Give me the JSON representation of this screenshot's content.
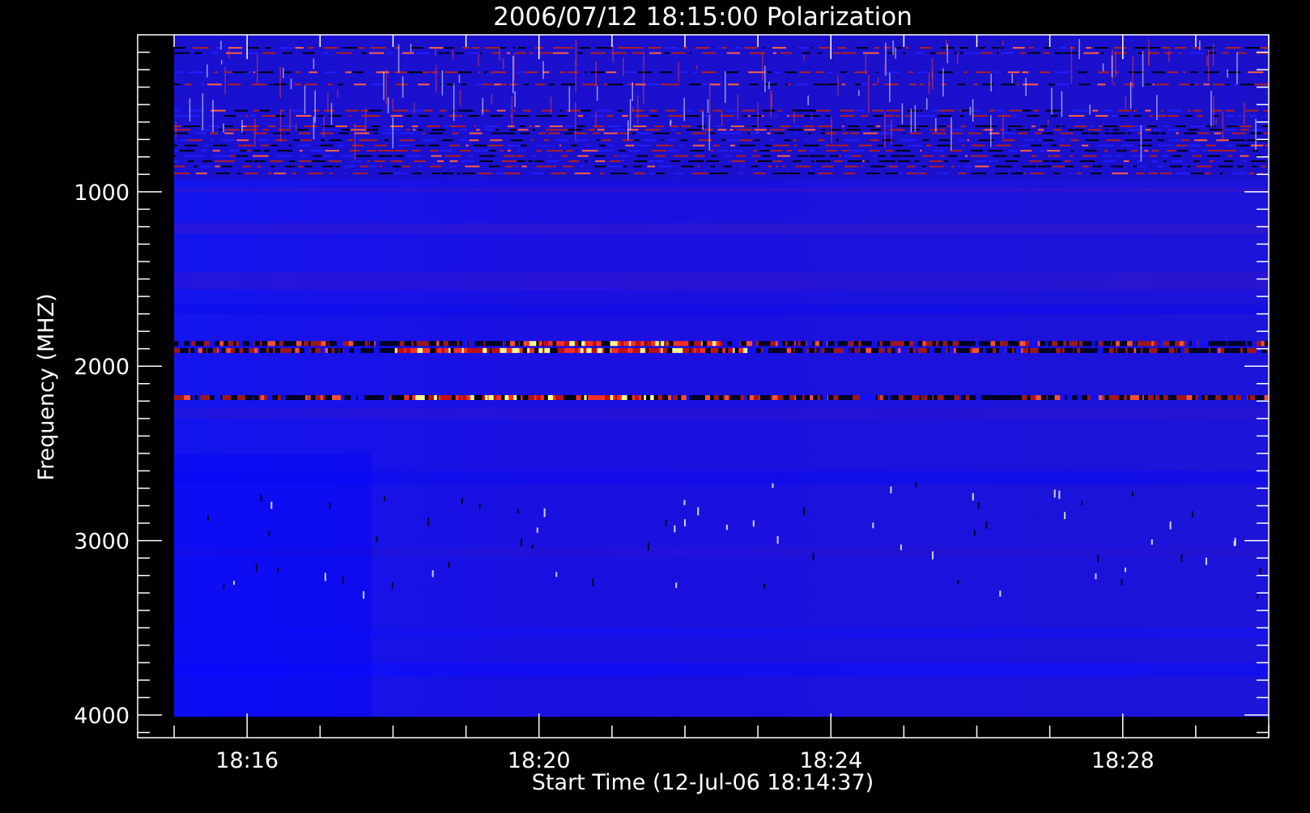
{
  "chart_data": {
    "type": "heatmap",
    "title": "2006/07/12 18:15:00 Polarization",
    "xlabel": "Start Time (12-Jul-06 18:14:37)",
    "ylabel": "Frequency (MHZ)",
    "x_tick_labels": [
      "18:16",
      "18:20",
      "18:24",
      "18:28"
    ],
    "x_tick_minutes": [
      16,
      20,
      24,
      28
    ],
    "x_range_minutes": [
      14.5,
      30
    ],
    "x_data_range_minutes": [
      15,
      30
    ],
    "y_tick_labels": [
      "1000",
      "2000",
      "3000",
      "4000"
    ],
    "y_tick_values": [
      1000,
      2000,
      3000,
      4000
    ],
    "y_range": [
      100,
      4130
    ],
    "y_data_range": [
      100,
      4010
    ],
    "colormap": [
      "#000000",
      "#0000ff",
      "#e02020",
      "#ffff80"
    ],
    "background_color": "#0a0ae6",
    "features": [
      {
        "band": [
          100,
          930
        ],
        "type": "noisy RFI region"
      },
      {
        "freq": 1870,
        "type": "bright horizontal band"
      },
      {
        "freq": 1910,
        "type": "bright horizontal band"
      },
      {
        "freq": 2180,
        "type": "bright horizontal band"
      }
    ]
  }
}
